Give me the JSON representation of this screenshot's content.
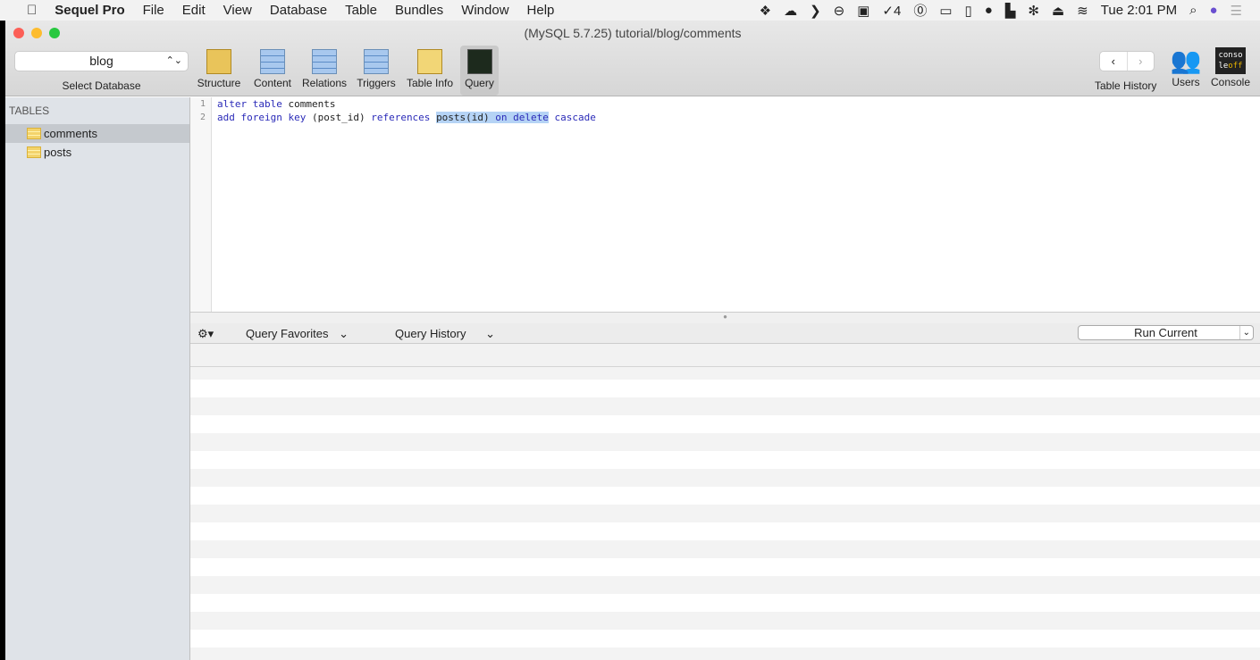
{
  "menubar": {
    "app": "Sequel Pro",
    "items": [
      "File",
      "Edit",
      "View",
      "Database",
      "Table",
      "Bundles",
      "Window",
      "Help"
    ],
    "status_count": "4",
    "clock": "Tue 2:01 PM"
  },
  "window": {
    "title": "(MySQL 5.7.25) tutorial/blog/comments"
  },
  "toolbar": {
    "database": "blog",
    "database_label": "Select Database",
    "items": [
      "Structure",
      "Content",
      "Relations",
      "Triggers",
      "Table Info",
      "Query"
    ],
    "selected": "Query",
    "table_history": "Table History",
    "users": "Users",
    "console": "Console",
    "console_icon_text": "conso le off"
  },
  "sidebar": {
    "header": "TABLES",
    "tables": [
      "comments",
      "posts"
    ],
    "selected": "comments"
  },
  "editor": {
    "lines": [
      {
        "n": "1",
        "kw": "alter table",
        "rest": " comments"
      },
      {
        "n": "2",
        "kw1": "add foreign key",
        "mid": " (post_id) ",
        "kw2": "references ",
        "sel1": "posts(id) ",
        "sel2": "on delete",
        "tail": " cascade"
      }
    ]
  },
  "query_bar": {
    "favorites": "Query Favorites",
    "history": "Query History",
    "run": "Run Current"
  }
}
